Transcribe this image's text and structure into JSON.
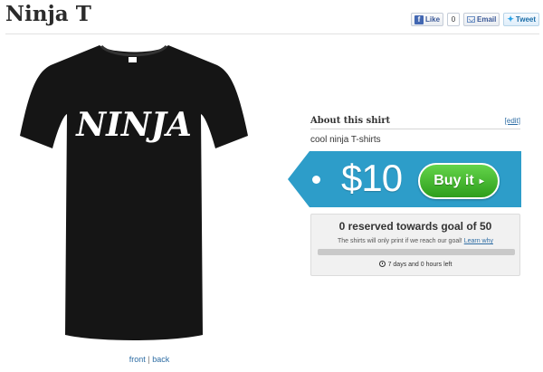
{
  "header": {
    "title": "Ninja T"
  },
  "social": {
    "like_label": "Like",
    "like_count": "0",
    "email_label": "Email",
    "tweet_label": "Tweet"
  },
  "product": {
    "shirt_print": "NINJA",
    "shirt_color": "#151515",
    "views": {
      "front": "front",
      "separator": "|",
      "back": "back"
    }
  },
  "about": {
    "title": "About this shirt",
    "edit_label": "[edit]",
    "description": "cool ninja T-shirts"
  },
  "purchase": {
    "price": "$10",
    "buy_label": "Buy it",
    "tag_color": "#2d9dc9"
  },
  "campaign": {
    "goal_text": "0 reserved towards goal of 50",
    "note": "The shirts will only print if we reach our goal!",
    "learn_why": "Learn why",
    "progress": 0,
    "time_left": "7 days and 0 hours left"
  }
}
